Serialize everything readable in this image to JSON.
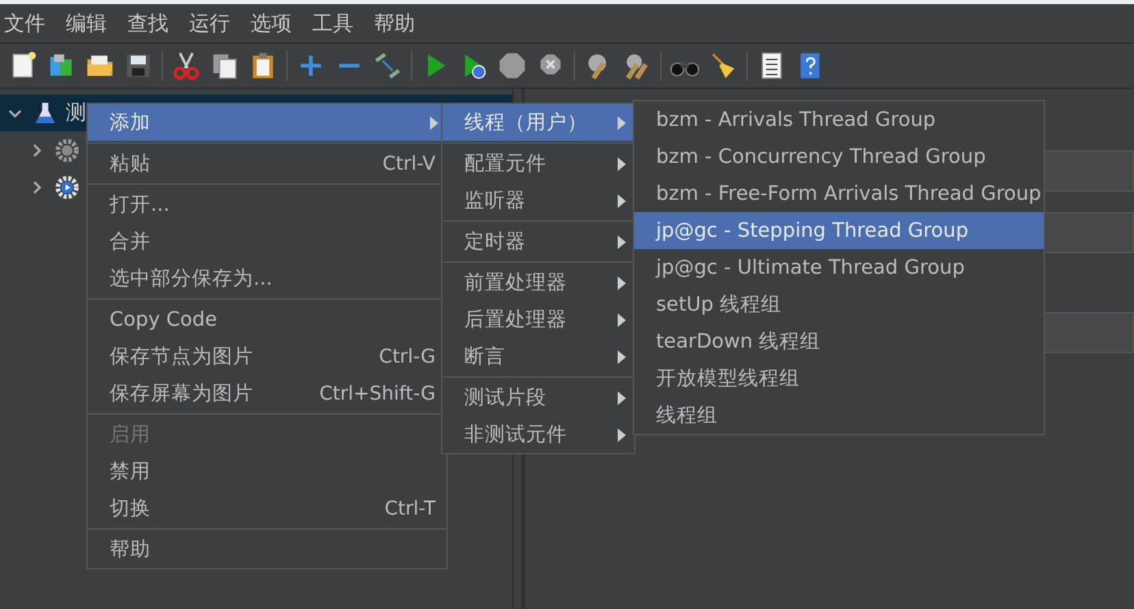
{
  "menubar": [
    "文件",
    "编辑",
    "查找",
    "运行",
    "选项",
    "工具",
    "帮助"
  ],
  "tree": {
    "label": "测",
    "expanded": true,
    "selected": true,
    "children": [
      {
        "kind": "gear",
        "expanded": false
      },
      {
        "kind": "gear-play",
        "expanded": false
      }
    ]
  },
  "menus": [
    {
      "groups": [
        [
          {
            "label": "添加",
            "submenu": true,
            "selected": true,
            "disabled": false
          }
        ],
        [
          {
            "label": "粘贴",
            "shortcut": "Ctrl-V",
            "submenu": false,
            "selected": false,
            "disabled": false
          }
        ],
        [
          {
            "label": "打开...",
            "submenu": false,
            "selected": false,
            "disabled": false
          },
          {
            "label": "合并",
            "submenu": false,
            "selected": false,
            "disabled": false
          },
          {
            "label": "选中部分保存为...",
            "submenu": false,
            "selected": false,
            "disabled": false
          }
        ],
        [
          {
            "label": "Copy Code",
            "submenu": false,
            "selected": false,
            "disabled": false
          },
          {
            "label": "保存节点为图片",
            "shortcut": "Ctrl-G",
            "submenu": false,
            "selected": false,
            "disabled": false
          },
          {
            "label": "保存屏幕为图片",
            "shortcut": "Ctrl+Shift-G",
            "submenu": false,
            "selected": false,
            "disabled": false
          }
        ],
        [
          {
            "label": "启用",
            "submenu": false,
            "selected": false,
            "disabled": true
          },
          {
            "label": "禁用",
            "submenu": false,
            "selected": false,
            "disabled": false
          },
          {
            "label": "切换",
            "shortcut": "Ctrl-T",
            "submenu": false,
            "selected": false,
            "disabled": false
          }
        ],
        [
          {
            "label": "帮助",
            "submenu": false,
            "selected": false,
            "disabled": false
          }
        ]
      ]
    },
    {
      "groups": [
        [
          {
            "label": "线程（用户）",
            "submenu": true,
            "selected": true
          }
        ],
        [
          {
            "label": "配置元件",
            "submenu": true,
            "selected": false
          },
          {
            "label": "监听器",
            "submenu": true,
            "selected": false
          }
        ],
        [
          {
            "label": "定时器",
            "submenu": true,
            "selected": false
          }
        ],
        [
          {
            "label": "前置处理器",
            "submenu": true,
            "selected": false
          },
          {
            "label": "后置处理器",
            "submenu": true,
            "selected": false
          },
          {
            "label": "断言",
            "submenu": true,
            "selected": false
          }
        ],
        [
          {
            "label": "测试片段",
            "submenu": true,
            "selected": false
          },
          {
            "label": "非测试元件",
            "submenu": true,
            "selected": false
          }
        ]
      ]
    },
    {
      "groups": [
        [
          {
            "label": "bzm - Arrivals Thread Group",
            "selected": false
          },
          {
            "label": "bzm - Concurrency Thread Group",
            "selected": false
          },
          {
            "label": "bzm - Free-Form Arrivals Thread Group",
            "selected": false
          },
          {
            "label": "jp@gc - Stepping Thread Group",
            "selected": true
          },
          {
            "label": "jp@gc - Ultimate Thread Group",
            "selected": false
          },
          {
            "label": "setUp 线程组",
            "selected": false
          },
          {
            "label": "tearDown 线程组",
            "selected": false
          },
          {
            "label": "开放模型线程组",
            "selected": false
          },
          {
            "label": "线程组",
            "selected": false
          }
        ]
      ]
    }
  ]
}
